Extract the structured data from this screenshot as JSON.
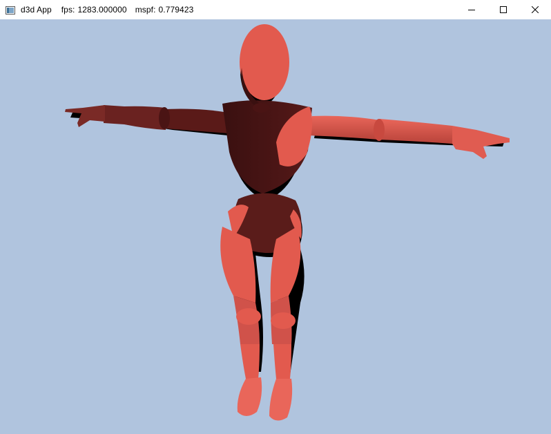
{
  "window": {
    "title": "d3d App",
    "fps_label": "fps:",
    "fps_value": "1283.000000",
    "mspf_label": "mspf:",
    "mspf_value": "0.779423",
    "controls": [
      "minimize-icon",
      "maximize-icon",
      "close-icon"
    ]
  },
  "viewport": {
    "background_color": "#b0c4de",
    "model_color": "#e2574c",
    "shadow_color": "#000000"
  }
}
